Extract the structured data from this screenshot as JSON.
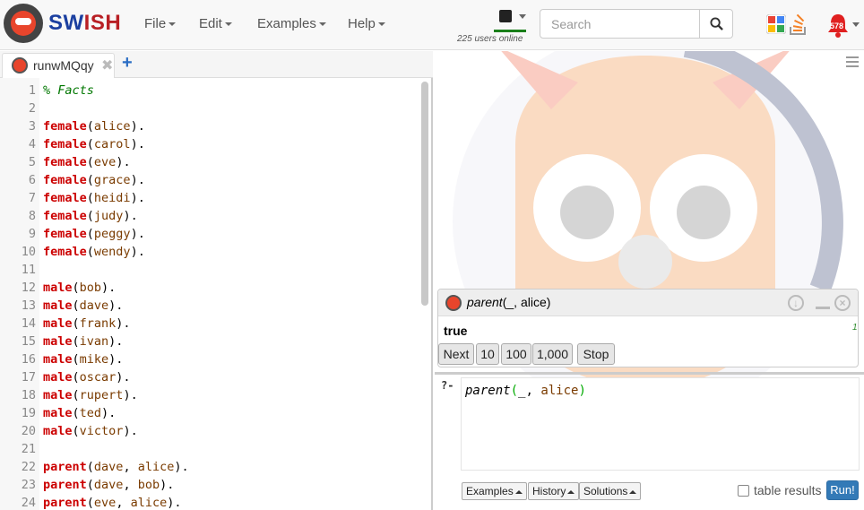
{
  "app": {
    "name_part1": "SW",
    "name_part2": "ISH"
  },
  "menu": {
    "file": "File",
    "edit": "Edit",
    "examples": "Examples",
    "help": "Help"
  },
  "status": {
    "users_online": "225 users online"
  },
  "search": {
    "placeholder": "Search"
  },
  "notifications": {
    "badge": "578"
  },
  "tabs": [
    {
      "label": "runwMQqy",
      "close": "✖"
    }
  ],
  "tab_add": "+",
  "editor": {
    "lines": [
      {
        "n": "1",
        "parts": [
          {
            "t": "% Facts",
            "c": "cm"
          }
        ]
      },
      {
        "n": "2",
        "parts": []
      },
      {
        "n": "3",
        "parts": [
          {
            "t": "female",
            "c": "kw"
          },
          {
            "t": "(",
            "c": "pn"
          },
          {
            "t": "alice",
            "c": "at"
          },
          {
            "t": ").",
            "c": "pn"
          }
        ]
      },
      {
        "n": "4",
        "parts": [
          {
            "t": "female",
            "c": "kw"
          },
          {
            "t": "(",
            "c": "pn"
          },
          {
            "t": "carol",
            "c": "at"
          },
          {
            "t": ").",
            "c": "pn"
          }
        ]
      },
      {
        "n": "5",
        "parts": [
          {
            "t": "female",
            "c": "kw"
          },
          {
            "t": "(",
            "c": "pn"
          },
          {
            "t": "eve",
            "c": "at"
          },
          {
            "t": ").",
            "c": "pn"
          }
        ]
      },
      {
        "n": "6",
        "parts": [
          {
            "t": "female",
            "c": "kw"
          },
          {
            "t": "(",
            "c": "pn"
          },
          {
            "t": "grace",
            "c": "at"
          },
          {
            "t": ").",
            "c": "pn"
          }
        ]
      },
      {
        "n": "7",
        "parts": [
          {
            "t": "female",
            "c": "kw"
          },
          {
            "t": "(",
            "c": "pn"
          },
          {
            "t": "heidi",
            "c": "at"
          },
          {
            "t": ").",
            "c": "pn"
          }
        ]
      },
      {
        "n": "8",
        "parts": [
          {
            "t": "female",
            "c": "kw"
          },
          {
            "t": "(",
            "c": "pn"
          },
          {
            "t": "judy",
            "c": "at"
          },
          {
            "t": ").",
            "c": "pn"
          }
        ]
      },
      {
        "n": "9",
        "parts": [
          {
            "t": "female",
            "c": "kw"
          },
          {
            "t": "(",
            "c": "pn"
          },
          {
            "t": "peggy",
            "c": "at"
          },
          {
            "t": ").",
            "c": "pn"
          }
        ]
      },
      {
        "n": "10",
        "parts": [
          {
            "t": "female",
            "c": "kw"
          },
          {
            "t": "(",
            "c": "pn"
          },
          {
            "t": "wendy",
            "c": "at"
          },
          {
            "t": ").",
            "c": "pn"
          }
        ]
      },
      {
        "n": "11",
        "parts": []
      },
      {
        "n": "12",
        "parts": [
          {
            "t": "male",
            "c": "kw"
          },
          {
            "t": "(",
            "c": "pn"
          },
          {
            "t": "bob",
            "c": "at"
          },
          {
            "t": ").",
            "c": "pn"
          }
        ]
      },
      {
        "n": "13",
        "parts": [
          {
            "t": "male",
            "c": "kw"
          },
          {
            "t": "(",
            "c": "pn"
          },
          {
            "t": "dave",
            "c": "at"
          },
          {
            "t": ").",
            "c": "pn"
          }
        ]
      },
      {
        "n": "14",
        "parts": [
          {
            "t": "male",
            "c": "kw"
          },
          {
            "t": "(",
            "c": "pn"
          },
          {
            "t": "frank",
            "c": "at"
          },
          {
            "t": ").",
            "c": "pn"
          }
        ]
      },
      {
        "n": "15",
        "parts": [
          {
            "t": "male",
            "c": "kw"
          },
          {
            "t": "(",
            "c": "pn"
          },
          {
            "t": "ivan",
            "c": "at"
          },
          {
            "t": ").",
            "c": "pn"
          }
        ]
      },
      {
        "n": "16",
        "parts": [
          {
            "t": "male",
            "c": "kw"
          },
          {
            "t": "(",
            "c": "pn"
          },
          {
            "t": "mike",
            "c": "at"
          },
          {
            "t": ").",
            "c": "pn"
          }
        ]
      },
      {
        "n": "17",
        "parts": [
          {
            "t": "male",
            "c": "kw"
          },
          {
            "t": "(",
            "c": "pn"
          },
          {
            "t": "oscar",
            "c": "at"
          },
          {
            "t": ").",
            "c": "pn"
          }
        ]
      },
      {
        "n": "18",
        "parts": [
          {
            "t": "male",
            "c": "kw"
          },
          {
            "t": "(",
            "c": "pn"
          },
          {
            "t": "rupert",
            "c": "at"
          },
          {
            "t": ").",
            "c": "pn"
          }
        ]
      },
      {
        "n": "19",
        "parts": [
          {
            "t": "male",
            "c": "kw"
          },
          {
            "t": "(",
            "c": "pn"
          },
          {
            "t": "ted",
            "c": "at"
          },
          {
            "t": ").",
            "c": "pn"
          }
        ]
      },
      {
        "n": "20",
        "parts": [
          {
            "t": "male",
            "c": "kw"
          },
          {
            "t": "(",
            "c": "pn"
          },
          {
            "t": "victor",
            "c": "at"
          },
          {
            "t": ").",
            "c": "pn"
          }
        ]
      },
      {
        "n": "21",
        "parts": []
      },
      {
        "n": "22",
        "parts": [
          {
            "t": "parent",
            "c": "kw"
          },
          {
            "t": "(",
            "c": "pn"
          },
          {
            "t": "dave",
            "c": "at"
          },
          {
            "t": ", ",
            "c": "pn"
          },
          {
            "t": "alice",
            "c": "at"
          },
          {
            "t": ").",
            "c": "pn"
          }
        ]
      },
      {
        "n": "23",
        "parts": [
          {
            "t": "parent",
            "c": "kw"
          },
          {
            "t": "(",
            "c": "pn"
          },
          {
            "t": "dave",
            "c": "at"
          },
          {
            "t": ", ",
            "c": "pn"
          },
          {
            "t": "bob",
            "c": "at"
          },
          {
            "t": ").",
            "c": "pn"
          }
        ]
      },
      {
        "n": "24",
        "parts": [
          {
            "t": "parent",
            "c": "kw"
          },
          {
            "t": "(",
            "c": "pn"
          },
          {
            "t": "eve",
            "c": "at"
          },
          {
            "t": ", ",
            "c": "pn"
          },
          {
            "t": "alice",
            "c": "at"
          },
          {
            "t": ").",
            "c": "pn"
          }
        ]
      }
    ]
  },
  "answer": {
    "query_fn": "parent",
    "query_open": "(",
    "query_var": "_",
    "query_rest": ", alice)",
    "result": "true",
    "count": "1",
    "buttons": {
      "next": "Next",
      "ten": "10",
      "hundred": "100",
      "thousand": "1,000",
      "stop": "Stop"
    }
  },
  "query": {
    "prompt": "?-",
    "fn": "parent",
    "open": "(",
    "var": "_",
    "comma": ", ",
    "arg": "alice",
    "close": ")"
  },
  "bottom": {
    "examples": "Examples",
    "history": "History",
    "solutions": "Solutions",
    "table_results": "table results",
    "run": "Run!"
  },
  "colors": {
    "run_button": "#337ab7",
    "keyword": "#cc0000",
    "atom": "#7a3b00",
    "comment": "#007700"
  }
}
